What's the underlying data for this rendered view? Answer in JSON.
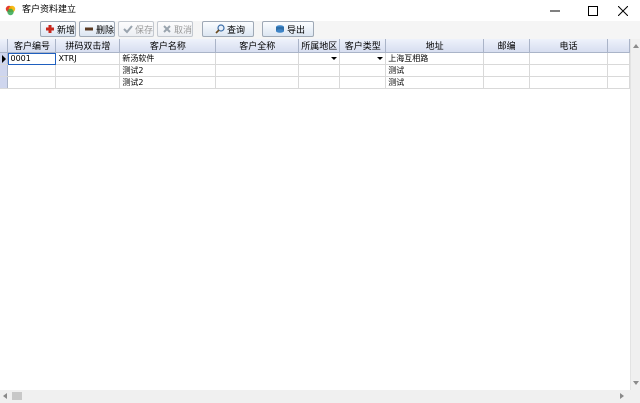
{
  "window": {
    "title": "客户资料建立",
    "icons": {
      "app": "app-logo-icon",
      "minimize": "minimize-icon",
      "maximize": "maximize-icon",
      "close": "close-icon"
    }
  },
  "toolbar": {
    "buttons": [
      {
        "label": "新增",
        "icon": "plus-icon",
        "enabled": true
      },
      {
        "label": "删除",
        "icon": "minus-icon",
        "enabled": true
      },
      {
        "label": "保存",
        "icon": "check-icon",
        "enabled": false
      },
      {
        "label": "取消",
        "icon": "x-icon",
        "enabled": false
      },
      {
        "label": "查询",
        "icon": "search-icon",
        "enabled": true
      },
      {
        "label": "导出",
        "icon": "export-icon",
        "enabled": true
      }
    ]
  },
  "grid": {
    "columns": [
      "",
      "客户编号",
      "拼码双击增",
      "客户名称",
      "客户全称",
      "所属地区",
      "客户类型",
      "地址",
      "邮编",
      "电话"
    ],
    "rows": [
      {
        "current": true,
        "cells": [
          "0001",
          "XTRJ",
          "新汤软件",
          "",
          "",
          "",
          "上海互相路",
          "",
          ""
        ]
      },
      {
        "current": false,
        "cells": [
          "",
          "",
          "测试2",
          "",
          "",
          "",
          "测试",
          "",
          ""
        ]
      },
      {
        "current": false,
        "cells": [
          "",
          "",
          "测试2",
          "",
          "",
          "",
          "测试",
          "",
          ""
        ]
      }
    ]
  },
  "colors": {
    "header": "#d7def0",
    "rowHeader": "#cfd6ee",
    "selection": "#1f5fbf"
  }
}
